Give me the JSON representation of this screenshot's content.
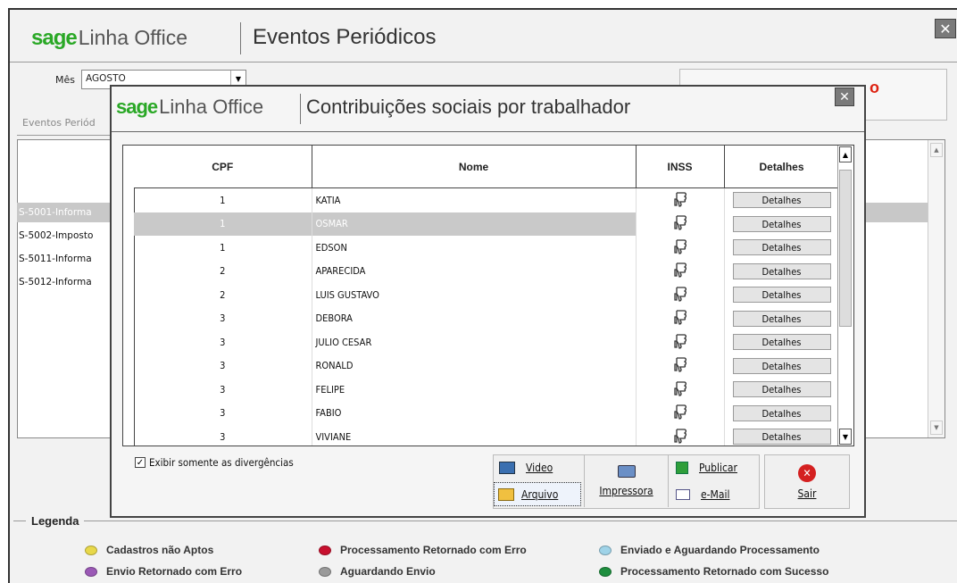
{
  "main_window": {
    "brand_sage": "sage",
    "brand_product": "Linha Office",
    "title": "Eventos Periódicos",
    "close_glyph": "✕",
    "month_label": "Mês",
    "month_value": "AGOSTO",
    "tab_label": "Eventos Periód",
    "partial_label": "o",
    "bg_rows": [
      "S-5001-Informa",
      "S-5002-Imposto",
      "S-5011-Informa",
      "S-5012-Informa"
    ]
  },
  "dialog": {
    "brand_sage": "sage",
    "brand_product": "Linha Office",
    "title": "Contribuições sociais por trabalhador",
    "close_glyph": "✕",
    "columns": {
      "cpf": "CPF",
      "nome": "Nome",
      "inss": "INSS",
      "detalhes": "Detalhes"
    },
    "rows": [
      {
        "cpf": "1",
        "nome": "KATIA",
        "detalhes": "Detalhes"
      },
      {
        "cpf": "1",
        "nome": "OSMAR",
        "detalhes": "Detalhes"
      },
      {
        "cpf": "1",
        "nome": "EDSON",
        "detalhes": "Detalhes"
      },
      {
        "cpf": "2",
        "nome": "APARECIDA",
        "detalhes": "Detalhes"
      },
      {
        "cpf": "2",
        "nome": "LUIS GUSTAVO",
        "detalhes": "Detalhes"
      },
      {
        "cpf": "3",
        "nome": "DEBORA",
        "detalhes": "Detalhes"
      },
      {
        "cpf": "3",
        "nome": "JULIO CESAR",
        "detalhes": "Detalhes"
      },
      {
        "cpf": "3",
        "nome": "RONALD",
        "detalhes": "Detalhes"
      },
      {
        "cpf": "3",
        "nome": "FELIPE",
        "detalhes": "Detalhes"
      },
      {
        "cpf": "3",
        "nome": "FABIO",
        "detalhes": "Detalhes"
      },
      {
        "cpf": "3",
        "nome": "VIVIANE",
        "detalhes": "Detalhes"
      }
    ],
    "checkbox_label": "Exibir somente as divergências",
    "checkbox_checked": true,
    "buttons": {
      "video": "Video",
      "arquivo": "Arquivo",
      "impressora": "Impressora",
      "publicar": "Publicar",
      "email": "e-Mail",
      "sair": "Sair"
    }
  },
  "legend": {
    "title": "Legenda",
    "items": [
      {
        "label": "Cadastros não Aptos",
        "color": "#e8d84a"
      },
      {
        "label": "Processamento Retornado com Erro",
        "color": "#c8102e"
      },
      {
        "label": "Enviado e Aguardando Processamento",
        "color": "#9fd3e8"
      },
      {
        "label": "Envio Retornado com Erro",
        "color": "#9b59b6"
      },
      {
        "label": "Aguardando Envio",
        "color": "#9a9a9a"
      },
      {
        "label": "Processamento Retornado com Sucesso",
        "color": "#1e8e3e"
      }
    ]
  }
}
